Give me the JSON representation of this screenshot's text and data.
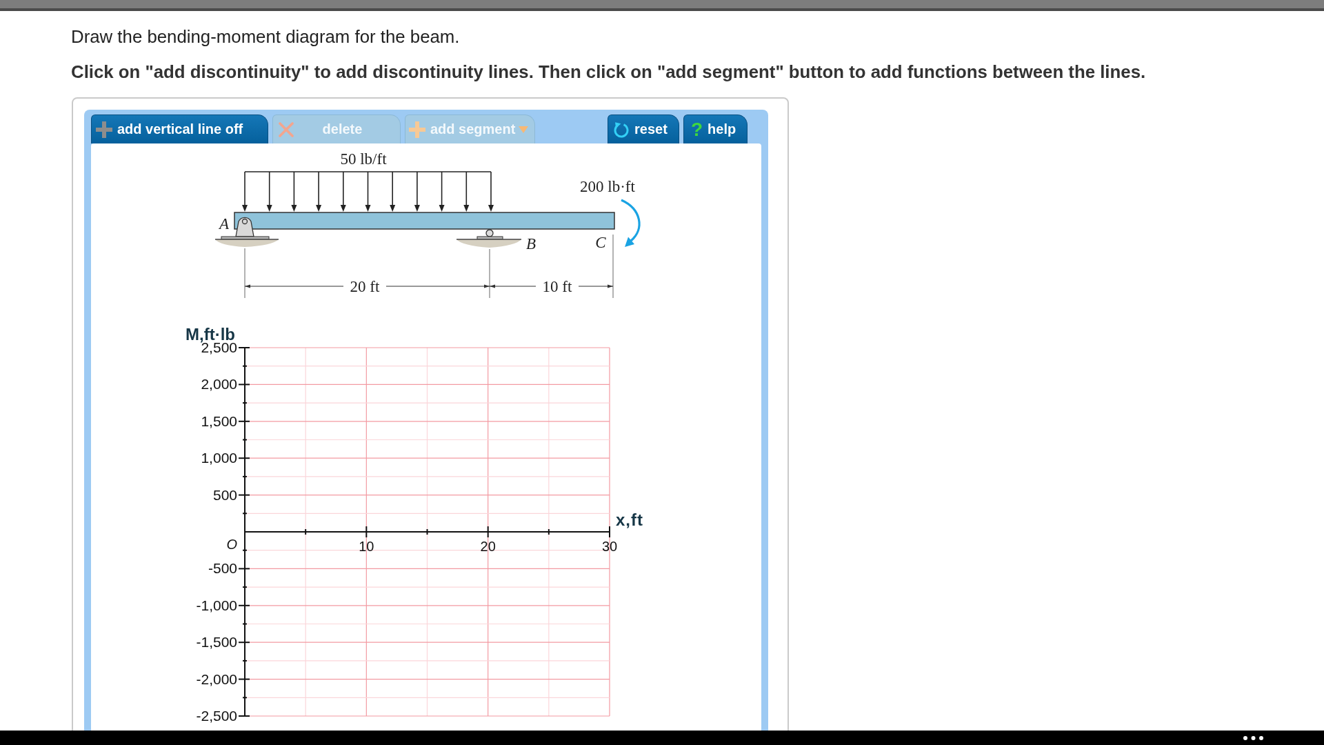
{
  "prompt": "Draw the bending-moment diagram for the beam.",
  "instruction": "Click on \"add discontinuity\" to add discontinuity lines. Then click on \"add segment\" button to add functions between the lines.",
  "toolbar": {
    "tools": [
      {
        "label": "add vertical line off",
        "kind": "add",
        "disabled": false
      },
      {
        "label": "delete",
        "kind": "delete",
        "disabled": true
      },
      {
        "label": "add segment",
        "kind": "menu",
        "disabled": true
      }
    ],
    "actions": [
      {
        "label": "reset",
        "kind": "reset",
        "disabled": false
      },
      {
        "label": "help",
        "kind": "help",
        "icon": "?",
        "disabled": false
      }
    ]
  },
  "figure": {
    "distributed_load": "50 lb/ft",
    "couple_moment": "200 lb·ft",
    "points": [
      {
        "label": "A",
        "kind": "pin"
      },
      {
        "label": "B",
        "kind": "roller"
      },
      {
        "label": "C",
        "kind": "end"
      }
    ],
    "spans": [
      "20 ft",
      "10 ft"
    ]
  },
  "graph": {
    "chart_data": {
      "type": "line",
      "grid": true,
      "xlabel": "x,ft",
      "ylabel": "M,ft·lb",
      "xlim": [
        0,
        30
      ],
      "ylim": [
        -2500,
        2500
      ],
      "xticks": [
        {
          "value": 0,
          "label": "O"
        },
        10,
        20,
        30
      ],
      "yticks": [
        {
          "value": 2500,
          "label": "2,500"
        },
        {
          "value": 2000,
          "label": "2,000"
        },
        {
          "value": 1500,
          "label": "1,500"
        },
        {
          "value": 1000,
          "label": "1,000"
        },
        500,
        -500,
        {
          "value": -1000,
          "label": "-1,000"
        },
        {
          "value": -1500,
          "label": "-1,500"
        },
        {
          "value": -2000,
          "label": "-2,000"
        },
        {
          "value": -2500,
          "label": "-2,500"
        }
      ]
    }
  }
}
